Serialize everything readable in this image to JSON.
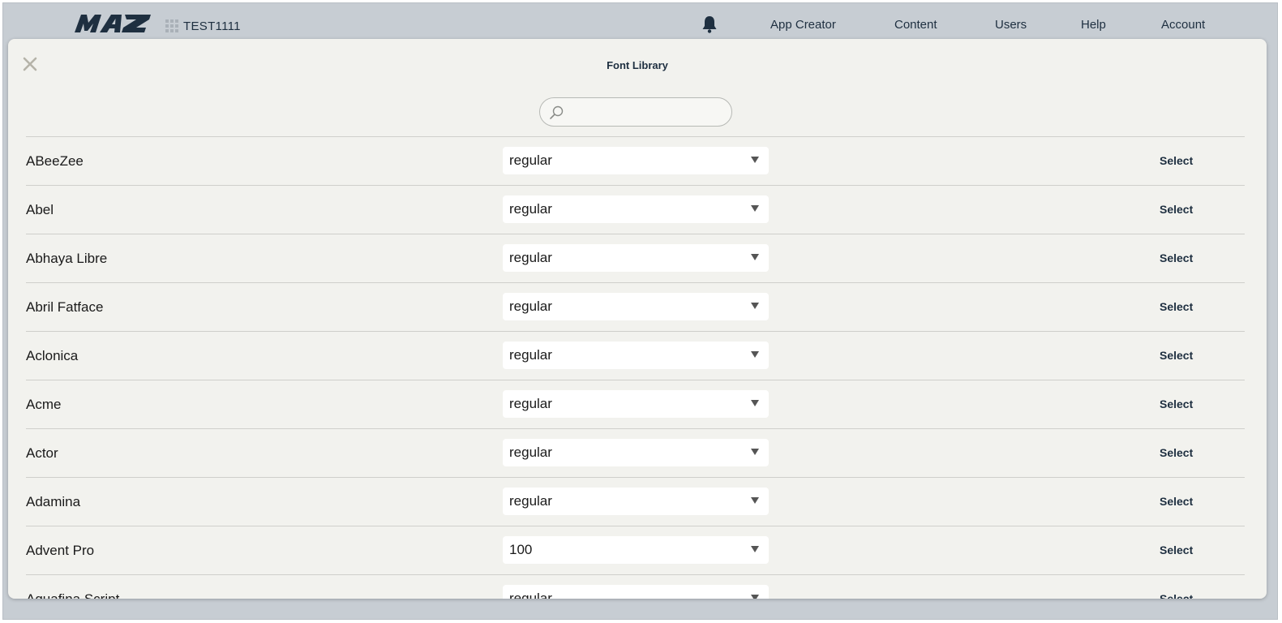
{
  "header": {
    "logo_text": "MAZ",
    "app_name": "TEST1111",
    "nav": [
      "App Creator",
      "Content",
      "Users",
      "Help",
      "Account"
    ]
  },
  "modal": {
    "title": "Font Library",
    "search": {
      "value": "",
      "placeholder": ""
    }
  },
  "fonts": [
    {
      "name": "ABeeZee",
      "variant": "regular",
      "action": "Select"
    },
    {
      "name": "Abel",
      "variant": "regular",
      "action": "Select"
    },
    {
      "name": "Abhaya Libre",
      "variant": "regular",
      "action": "Select"
    },
    {
      "name": "Abril Fatface",
      "variant": "regular",
      "action": "Select"
    },
    {
      "name": "Aclonica",
      "variant": "regular",
      "action": "Select"
    },
    {
      "name": "Acme",
      "variant": "regular",
      "action": "Select"
    },
    {
      "name": "Actor",
      "variant": "regular",
      "action": "Select"
    },
    {
      "name": "Adamina",
      "variant": "regular",
      "action": "Select"
    },
    {
      "name": "Advent Pro",
      "variant": "100",
      "action": "Select"
    },
    {
      "name": "Aguafina Script",
      "variant": "regular",
      "action": "Select"
    }
  ],
  "colors": {
    "brand": "#1e2f40",
    "modal_bg": "#f2f2ee",
    "page_bg": "#c7cdd3"
  }
}
